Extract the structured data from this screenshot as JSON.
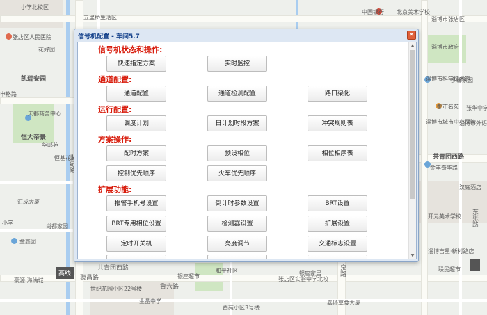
{
  "dialog": {
    "title": "信号机配置 - 车间5.7",
    "close_icon": "close-icon",
    "sections": {
      "s1": "信号机状态和操作:",
      "s2": "通道配置:",
      "s3": "运行配置:",
      "s4": "方案操作:",
      "s5": "扩展功能:"
    },
    "buttons": {
      "quick_plan": "快速指定方案",
      "realtime_monitor": "实时监控",
      "channel_config": "通道配置",
      "channel_detect_config": "通道检测配置",
      "intersection_render": "路口渠化",
      "schedule_plan": "调度计划",
      "daily_period_plan": "日计划时段方案",
      "conflict_table": "冲突规则表",
      "timing_plan": "配时方案",
      "preset_phase": "预设相位",
      "phase_sequence_table": "相位相序表",
      "control_priority_order": "控制优先顺序",
      "train_priority_order": "火车优先顺序",
      "alarm_phone_setting": "报警手机号设置",
      "countdown_param_setting": "倒计时参数设置",
      "brt_setting": "BRT设置",
      "brt_phase_setting": "BRT专用相位设置",
      "detector_setting": "检测器设置",
      "extension_setting": "扩展设置",
      "timed_switch": "定时开关机",
      "brightness_adjust": "亮度调节",
      "traffic_sign_setting": "交通标志设置"
    }
  },
  "map": {
    "labels": {
      "l1": "五里桥生活区",
      "l2": "张店区人民医院",
      "l3": "花好园",
      "l4": "凯瑞安园",
      "l5": "天都商务中心",
      "l6": "恒大帝景",
      "l7": "华邮苑",
      "l8": "恒基花苑",
      "l9": "汇成大厦",
      "l10": "小学",
      "l11": "尚都家园",
      "l12": "金鑫园",
      "l13": "豪源·海纳城",
      "l14": "中国银行",
      "l15": "北京美术学校",
      "l16": "淄博市政府",
      "l17": "淄博市科学技术馆",
      "l18": "多馨家园",
      "l19": "都市名苑",
      "l20": "张华中学",
      "l21": "淄博市城市中心医院",
      "l22": "淄博市外语实验学校",
      "l23": "共青团西路",
      "l24": "金丰奇华路",
      "l25": "汉庭酒店",
      "l26": "开元美术学校",
      "l27": "淄博吉星·新村路店",
      "l28": "联民超市",
      "l29": "和平社区",
      "l30": "银座超市",
      "l31": "张店区实验中学北校",
      "l32": "西苑小区3号楼",
      "l33": "嘉环草食大厦",
      "l34": "世纪路",
      "l35": "泉路",
      "l36": "鲁六路",
      "l37": "聚昌路",
      "l38": "东张路",
      "l39": "共青团西路",
      "l40": "小学北校区",
      "l41": "淄博市张店区",
      "l42": "申格路",
      "l43": "世纪花园小区22号楼",
      "l44": "金晶中学",
      "l45": "银座家居"
    },
    "badge_left": "高线"
  }
}
